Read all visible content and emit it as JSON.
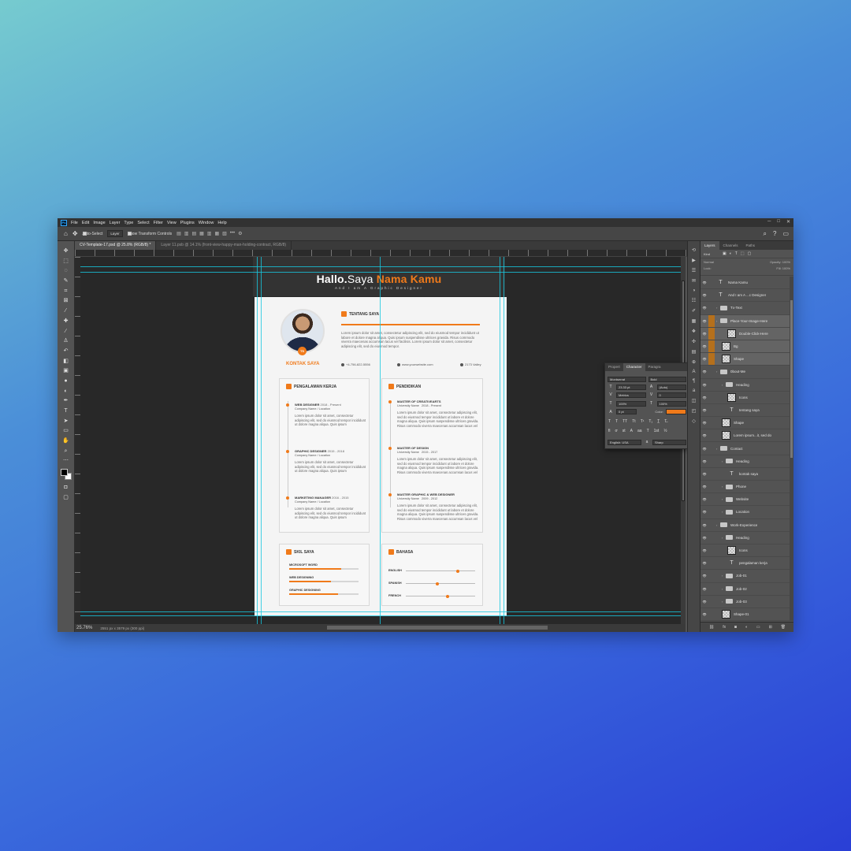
{
  "menu": [
    "File",
    "Edit",
    "Image",
    "Layer",
    "Type",
    "Select",
    "Filter",
    "View",
    "Plugins",
    "Window",
    "Help"
  ],
  "options": {
    "auto_select": "Auto-Select",
    "layer_select": "Layer",
    "show_transform": "Show Transform Controls"
  },
  "tabs": [
    {
      "label": "CV-Template-17.psd @ 25.8% (RGB/8) *",
      "active": true
    },
    {
      "label": "Layer 11.psb @ 14.1% (front-view-happy-man-holding-contract, RGB/8)",
      "active": false
    }
  ],
  "status": {
    "zoom": "25.76%",
    "dimensions": "2551 px x 3579 px (300 ppi)"
  },
  "doc": {
    "title_hallo": "Hallo.",
    "title_saya": "Saya ",
    "title_name": "Nama Kamu",
    "subtitle": "And I am A Graphic Designer",
    "photo_badge": "TS",
    "kontak_title": "KONTAK SAYA",
    "tentang_title": "TENTANG SAYA",
    "tentang_text": "Lorem ipsum dolor sit amet, consectetur adipiscing elit, sed do eiusmod tempor incididunt ut labore et dolore magna aliqua. Quis ipsum suspendisse ultrices gravida. Risus commodo viverra maecenas accumsan lacus vel facilisis. Lorem ipsum dolor sit amet, consectetur adipiscing elit, sed do eiusmod tempor.",
    "phone": "+4-756-822-5556",
    "website": "www.yourwebsite.com",
    "location": "2173 Valley",
    "pengalaman_title": "PENGALAMAN KERJA",
    "pendidikan_title": "PENDIDIKAN",
    "jobs": [
      {
        "title": "WEB DESIGNER",
        "years": "2018 - Present",
        "company": "Company Name / Location",
        "desc": "Lorem ipsum dolor sit amet, consectetur adipiscing elit, sed do eiusmod tempor incididunt ut dolore magna aliqua. Quis ipsum"
      },
      {
        "title": "GRAPHIC DESIGNER",
        "years": "2015 - 2018",
        "company": "Company Name / Location",
        "desc": "Lorem ipsum dolor sit amet, consectetur adipiscing elit, sed do eiusmod tempor incididunt ut dolore magna aliqua. Quis ipsum"
      },
      {
        "title": "MARKETING MANAGER",
        "years": "2016 - 2015",
        "company": "Company Name / Location",
        "desc": "Lorem ipsum dolor sit amet, consectetur adipiscing elit, sed do eiusmod tempor incididunt ut dolore magna aliqua. Quis ipsum"
      }
    ],
    "education": [
      {
        "title": "MASTER OF CREATIVEARTS",
        "school": "University Name",
        "years": "2018 - Present",
        "desc": "Lorem ipsum dolor sit amet, consectetur adipiscing elit, sed do eiusmod tempor incididunt ut labore et dolore magna aliqua. Quis ipsum suspendisse ultrices gravida. Risus commodo viverra maecenas accumsan lacus vel facilisis. Lorem ipsum dolor sit amet, consectetur adipiscing elit, sed do eiusmod tempor incididunt ut labore et dolore magna aliqua. Quis ipsum suspendisse ultrices gravida. Risus commodo viverra maecenas accumsan lacus vel facilisis."
      },
      {
        "title": "MASTER OF DESIGN",
        "school": "University Name",
        "years": "2015 - 2017",
        "desc": "Lorem ipsum dolor sit amet, consectetur adipiscing elit, sed do eiusmod tempor incididunt ut labore et dolore magna aliqua. Quis ipsum suspendisse ultrices gravida. Risus commodo viverra maecenas accumsan lacus vel facilisis."
      },
      {
        "title": "MASTER GRAPHIC & WEB DESIGNER",
        "school": "University Name",
        "years": "2009 - 2012",
        "desc": "Lorem ipsum dolor sit amet, consectetur adipiscing elit, sed do eiusmod tempor incididunt ut labore et dolore magna aliqua. Quis ipsum suspendisse ultrices gravida. Risus commodo viverra maecenas accumsan lacus vel facilisis."
      }
    ],
    "skill_title": "SKIL SAYA",
    "skills": [
      {
        "name": "MICROSOFT WORD",
        "level": 0.75
      },
      {
        "name": "WEB DESIGNING",
        "level": 0.6
      },
      {
        "name": "GRAPHIC DESIGNING",
        "level": 0.7
      }
    ],
    "bahasa_title": "BAHASA",
    "languages": [
      {
        "name": "ENGLISH",
        "level": 0.75
      },
      {
        "name": "SPANISH",
        "level": 0.45
      },
      {
        "name": "FRENCH",
        "level": 0.6
      }
    ]
  },
  "character_panel": {
    "tabs": [
      "Propert",
      "Character",
      "Paragra"
    ],
    "font_family": "Montserrat",
    "font_style": "Bold",
    "font_size": "23.33 pt",
    "leading": "(Auto)",
    "kerning": "Metrics",
    "tracking": "0",
    "vscale": "100%",
    "hscale": "100%",
    "baseline": "0 pt",
    "color_label": "Color:",
    "text_color": "#f07a1a",
    "language": "English: USA",
    "antialias": "Sharp"
  },
  "layers_panel": {
    "tabs": [
      "Layers",
      "Channels",
      "Paths"
    ],
    "kind": "Kind",
    "blend": "Normal",
    "opacity_label": "Opacity:",
    "opacity": "100%",
    "lock_label": "Lock:",
    "fill_label": "Fill:",
    "fill": "100%",
    "layers": [
      {
        "name": "Nama Kamu",
        "kind": "text",
        "indent": 0,
        "hl": false
      },
      {
        "name": "And I am A ...c Designer",
        "kind": "text",
        "indent": 0,
        "hl": false
      },
      {
        "name": "Tx-Text",
        "kind": "group",
        "indent": 0,
        "hl": false
      },
      {
        "name": "Place-Your-Image-Here",
        "kind": "group",
        "indent": 0,
        "hl": true
      },
      {
        "name": "Double-Click-Here",
        "kind": "thumb",
        "indent": 2,
        "hl": true
      },
      {
        "name": "Bg",
        "kind": "thumb",
        "indent": 1,
        "hl": true
      },
      {
        "name": "Shape",
        "kind": "thumb",
        "indent": 1,
        "hl": true
      },
      {
        "name": "0bout-Me",
        "kind": "group",
        "indent": 0,
        "hl": false
      },
      {
        "name": "Heading",
        "kind": "group",
        "indent": 1,
        "hl": false
      },
      {
        "name": "Icons",
        "kind": "thumb",
        "indent": 2,
        "hl": false
      },
      {
        "name": "tentang saya",
        "kind": "text",
        "indent": 2,
        "hl": false
      },
      {
        "name": "Shape",
        "kind": "thumb",
        "indent": 1,
        "hl": false
      },
      {
        "name": "Lorem ipsum...it, sed do",
        "kind": "thumb",
        "indent": 1,
        "hl": false
      },
      {
        "name": "Contact",
        "kind": "group",
        "indent": 0,
        "hl": false
      },
      {
        "name": "Heading",
        "kind": "group",
        "indent": 1,
        "hl": false
      },
      {
        "name": "kontak saya",
        "kind": "text",
        "indent": 2,
        "hl": false
      },
      {
        "name": "Phone",
        "kind": "group",
        "indent": 1,
        "hl": false
      },
      {
        "name": "Website",
        "kind": "group",
        "indent": 1,
        "hl": false
      },
      {
        "name": "Location",
        "kind": "group",
        "indent": 1,
        "hl": false
      },
      {
        "name": "Work-Experience",
        "kind": "group",
        "indent": 0,
        "hl": false
      },
      {
        "name": "Heading",
        "kind": "group",
        "indent": 1,
        "hl": false
      },
      {
        "name": "Icons",
        "kind": "thumb",
        "indent": 2,
        "hl": false
      },
      {
        "name": "pengalaman kerja",
        "kind": "text",
        "indent": 2,
        "hl": false
      },
      {
        "name": "Job-01",
        "kind": "group",
        "indent": 1,
        "hl": false
      },
      {
        "name": "Job-02",
        "kind": "group",
        "indent": 1,
        "hl": false
      },
      {
        "name": "Job-03",
        "kind": "group",
        "indent": 1,
        "hl": false
      },
      {
        "name": "Shape-01",
        "kind": "thumb",
        "indent": 1,
        "hl": false
      }
    ]
  }
}
